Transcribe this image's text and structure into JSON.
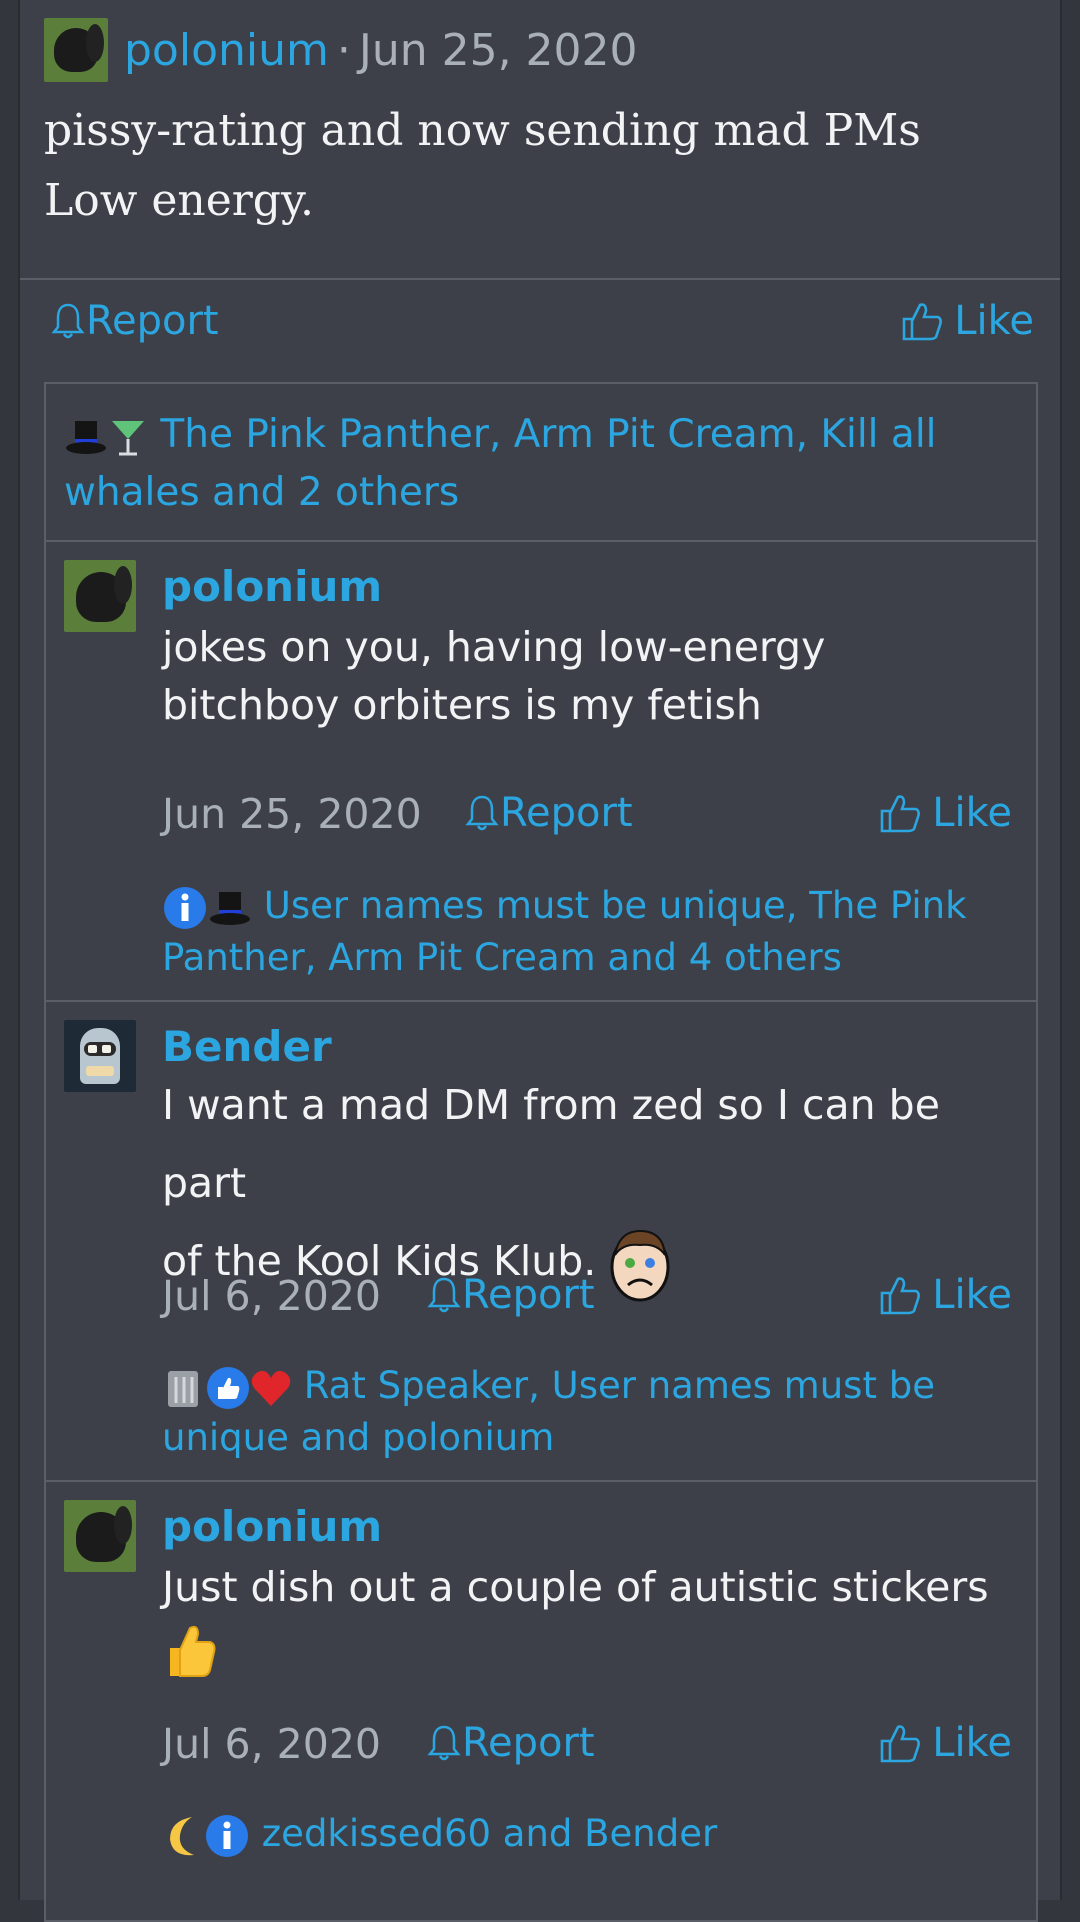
{
  "post": {
    "author": "polonium",
    "separator": "·",
    "date": "Jun 25, 2020",
    "body_line1": "pissy-rating and now sending mad PMs",
    "body_line2": "Low energy.",
    "report_label": "Report",
    "like_label": "Like",
    "reactions_text": "The Pink Panther, Arm Pit Cream, Kill all whales and 2 others"
  },
  "comments": [
    {
      "author": "polonium",
      "body": "jokes on you, having low-energy bitchboy orbiters is my fetish",
      "date": "Jun 25, 2020",
      "report_label": "Report",
      "like_label": "Like",
      "reactions_text": "User names must be unique, The Pink Panther, Arm Pit Cream and 4 others"
    },
    {
      "author": "Bender",
      "body_line1": "I want a mad DM from zed so I can be part",
      "body_line2": "of the Kool Kids Klub.",
      "date": "Jul 6, 2020",
      "report_label": "Report",
      "like_label": "Like",
      "reactions_text": "Rat Speaker, User names must be unique and polonium"
    },
    {
      "author": "polonium",
      "body": "Just dish out a couple of autistic stickers",
      "date": "Jul 6, 2020",
      "report_label": "Report",
      "like_label": "Like",
      "reactions_text": "zedkissed60 and Bender"
    }
  ],
  "colors": {
    "background": "#33363d",
    "panel": "#3d4048",
    "link": "#2ba6e0",
    "muted": "#aab0b8"
  },
  "icons": [
    "bell-icon",
    "thumbs-up-icon",
    "top-hat-icon",
    "cocktail-icon",
    "info-icon",
    "heart-icon",
    "moon-icon",
    "sad-face-emoji",
    "thumbs-up-emoji"
  ]
}
